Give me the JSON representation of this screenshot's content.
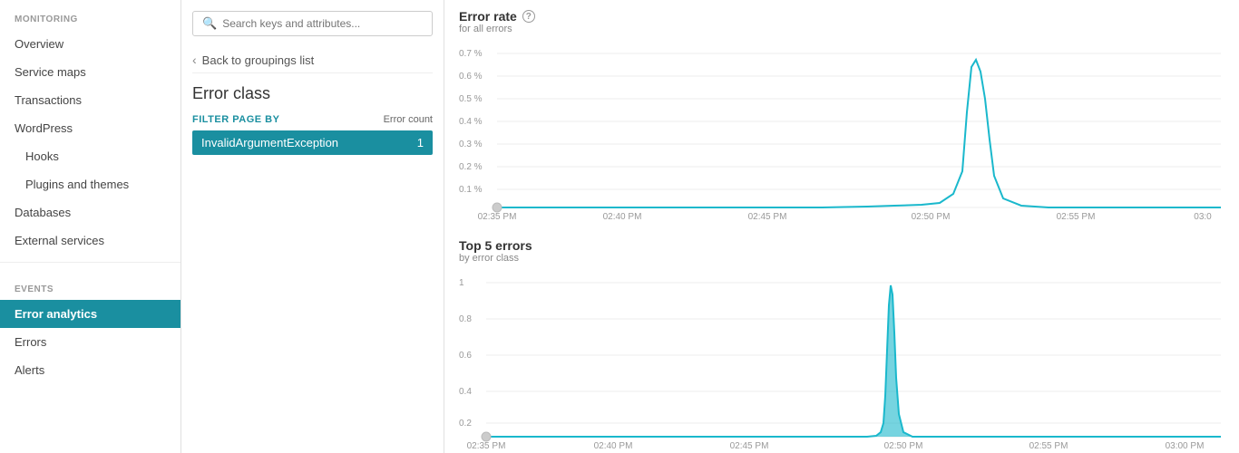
{
  "sidebar": {
    "monitoring_label": "MONITORING",
    "events_label": "EVENTS",
    "items": [
      {
        "label": "Overview",
        "id": "overview",
        "active": false,
        "sub": false
      },
      {
        "label": "Service maps",
        "id": "service-maps",
        "active": false,
        "sub": false
      },
      {
        "label": "Transactions",
        "id": "transactions",
        "active": false,
        "sub": false
      },
      {
        "label": "WordPress",
        "id": "wordpress",
        "active": false,
        "sub": false
      },
      {
        "label": "Hooks",
        "id": "hooks",
        "active": false,
        "sub": true
      },
      {
        "label": "Plugins and themes",
        "id": "plugins-themes",
        "active": false,
        "sub": true
      },
      {
        "label": "Databases",
        "id": "databases",
        "active": false,
        "sub": false
      },
      {
        "label": "External services",
        "id": "external-services",
        "active": false,
        "sub": false
      }
    ],
    "event_items": [
      {
        "label": "Error analytics",
        "id": "error-analytics",
        "active": true
      },
      {
        "label": "Errors",
        "id": "errors",
        "active": false
      },
      {
        "label": "Alerts",
        "id": "alerts",
        "active": false
      }
    ]
  },
  "filter": {
    "search_placeholder": "Search keys and attributes...",
    "back_label": "Back to groupings list",
    "title": "Error class",
    "by_label": "FILTER PAGE BY",
    "error_count_label": "Error count",
    "item_label": "InvalidArgumentException",
    "item_count": "1"
  },
  "chart1": {
    "title": "Error rate",
    "subtitle": "for all errors",
    "y_labels": [
      "0.7 %",
      "0.6 %",
      "0.5 %",
      "0.4 %",
      "0.3 %",
      "0.2 %",
      "0.1 %"
    ],
    "x_labels": [
      "02:35 PM",
      "02:40 PM",
      "02:45 PM",
      "02:50 PM",
      "02:55 PM",
      "03:0"
    ]
  },
  "chart2": {
    "title": "Top 5 errors",
    "subtitle": "by error class",
    "y_labels": [
      "1",
      "0.8",
      "0.6",
      "0.4",
      "0.2"
    ],
    "x_labels": [
      "02:35 PM",
      "02:40 PM",
      "02:45 PM",
      "02:50 PM",
      "02:55 PM",
      "03:00 PM"
    ]
  },
  "colors": {
    "active_bg": "#1a8fa0",
    "chart_line": "#1ab8cc",
    "chart_area": "#1ab8cc"
  }
}
